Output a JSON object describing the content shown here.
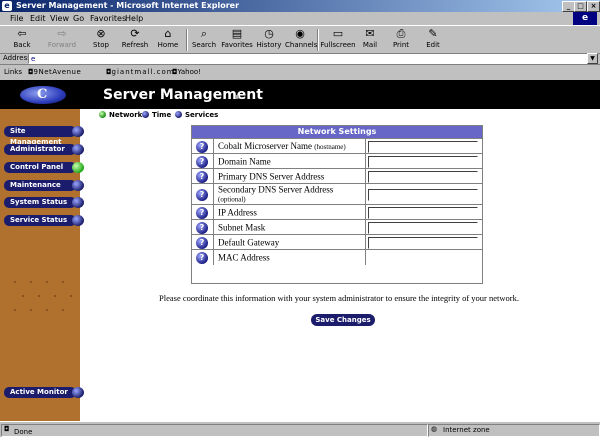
{
  "window": {
    "title": "Server Management - Microsoft Internet Explorer"
  },
  "menu": [
    "File",
    "Edit",
    "View",
    "Go",
    "Favorites",
    "Help"
  ],
  "toolbar": {
    "back": "Back",
    "forward": "Forward",
    "stop": "Stop",
    "refresh": "Refresh",
    "home": "Home",
    "search": "Search",
    "favorites": "Favorites",
    "history": "History",
    "channels": "Channels",
    "fullscreen": "Fullscreen",
    "mail": "Mail",
    "print": "Print",
    "edit": "Edit"
  },
  "address": {
    "label": "Address",
    "value": ""
  },
  "links": {
    "label": "Links",
    "items": [
      "9NetAvenue",
      "giantmall.com",
      "Yahoo!"
    ]
  },
  "page": {
    "title": "Server Management",
    "tabs": [
      "Network",
      "Time",
      "Services"
    ],
    "sidebar": {
      "items": [
        "Site Management",
        "Administrator",
        "Control Panel",
        "Maintenance",
        "System Status",
        "Service Status"
      ],
      "monitor": "Active Monitor"
    },
    "network_settings": {
      "heading": "Network Settings",
      "rows": [
        {
          "label": "Cobalt Microserver Name",
          "sub": "(hostname)",
          "value": ""
        },
        {
          "label": "Domain Name",
          "sub": "",
          "value": ""
        },
        {
          "label": "Primary DNS Server Address",
          "sub": "",
          "value": ""
        },
        {
          "label": "Secondary DNS Server Address",
          "sub": "(optional)",
          "value": ""
        },
        {
          "label": "IP Address",
          "sub": "",
          "value": ""
        },
        {
          "label": "Subnet Mask",
          "sub": "",
          "value": ""
        },
        {
          "label": "Default Gateway",
          "sub": "",
          "value": ""
        },
        {
          "label": "MAC Address",
          "sub": "",
          "value": ""
        }
      ]
    },
    "note": "Please coordinate this information with your system administrator to ensure the integrity of your network.",
    "save": "Save Changes"
  },
  "status": {
    "text": "Done",
    "zone": "Internet zone"
  },
  "colors": {
    "sidebar": "#b0702e",
    "table_header": "#6767c8",
    "button": "#1b1d6c",
    "active_indicator": "#21a91a"
  }
}
